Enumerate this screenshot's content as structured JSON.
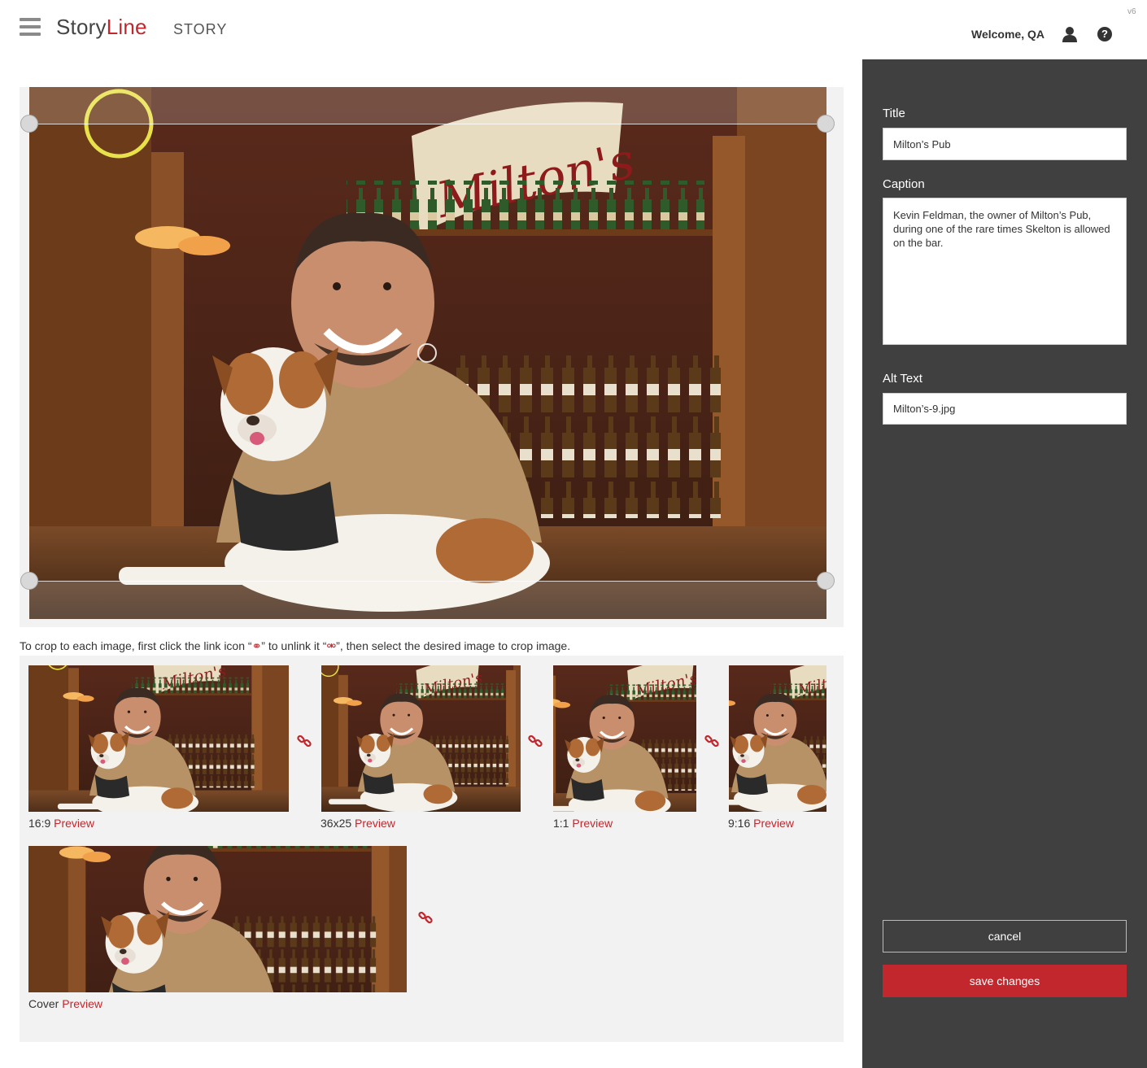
{
  "header": {
    "logo_part1": "Story",
    "logo_part2": "Line",
    "section": "STORY",
    "version": "v6",
    "welcome": "Welcome, QA",
    "icons": [
      "hamburger-menu-icon",
      "user-icon",
      "help-icon"
    ]
  },
  "editor": {
    "instructions_1": "To crop to each image, first click the link icon “",
    "instructions_2": "” to unlink it “",
    "instructions_3": "”, then select the desired image to crop image.",
    "link_glyph": "⚭",
    "unlink_glyph": "⚮"
  },
  "thumbnails": [
    {
      "ratio": "16:9",
      "preview": "Preview"
    },
    {
      "ratio": "36x25",
      "preview": "Preview"
    },
    {
      "ratio": "1:1",
      "preview": "Preview"
    },
    {
      "ratio": "9:16",
      "preview": "Preview"
    },
    {
      "ratio": "Cover",
      "preview": "Preview"
    }
  ],
  "sidebar": {
    "title_label": "Title",
    "title_value": "Milton’s Pub",
    "caption_label": "Caption",
    "caption_value": "Kevin Feldman, the owner of Milton’s Pub, during one of the rare times Skelton is allowed on the bar.",
    "alt_label": "Alt Text",
    "alt_value": "Milton’s-9.jpg",
    "cancel": "cancel",
    "save": "save changes"
  },
  "colors": {
    "accent": "#c1272d",
    "sidebar_bg": "#404040",
    "panel_bg": "#f2f2f2"
  }
}
